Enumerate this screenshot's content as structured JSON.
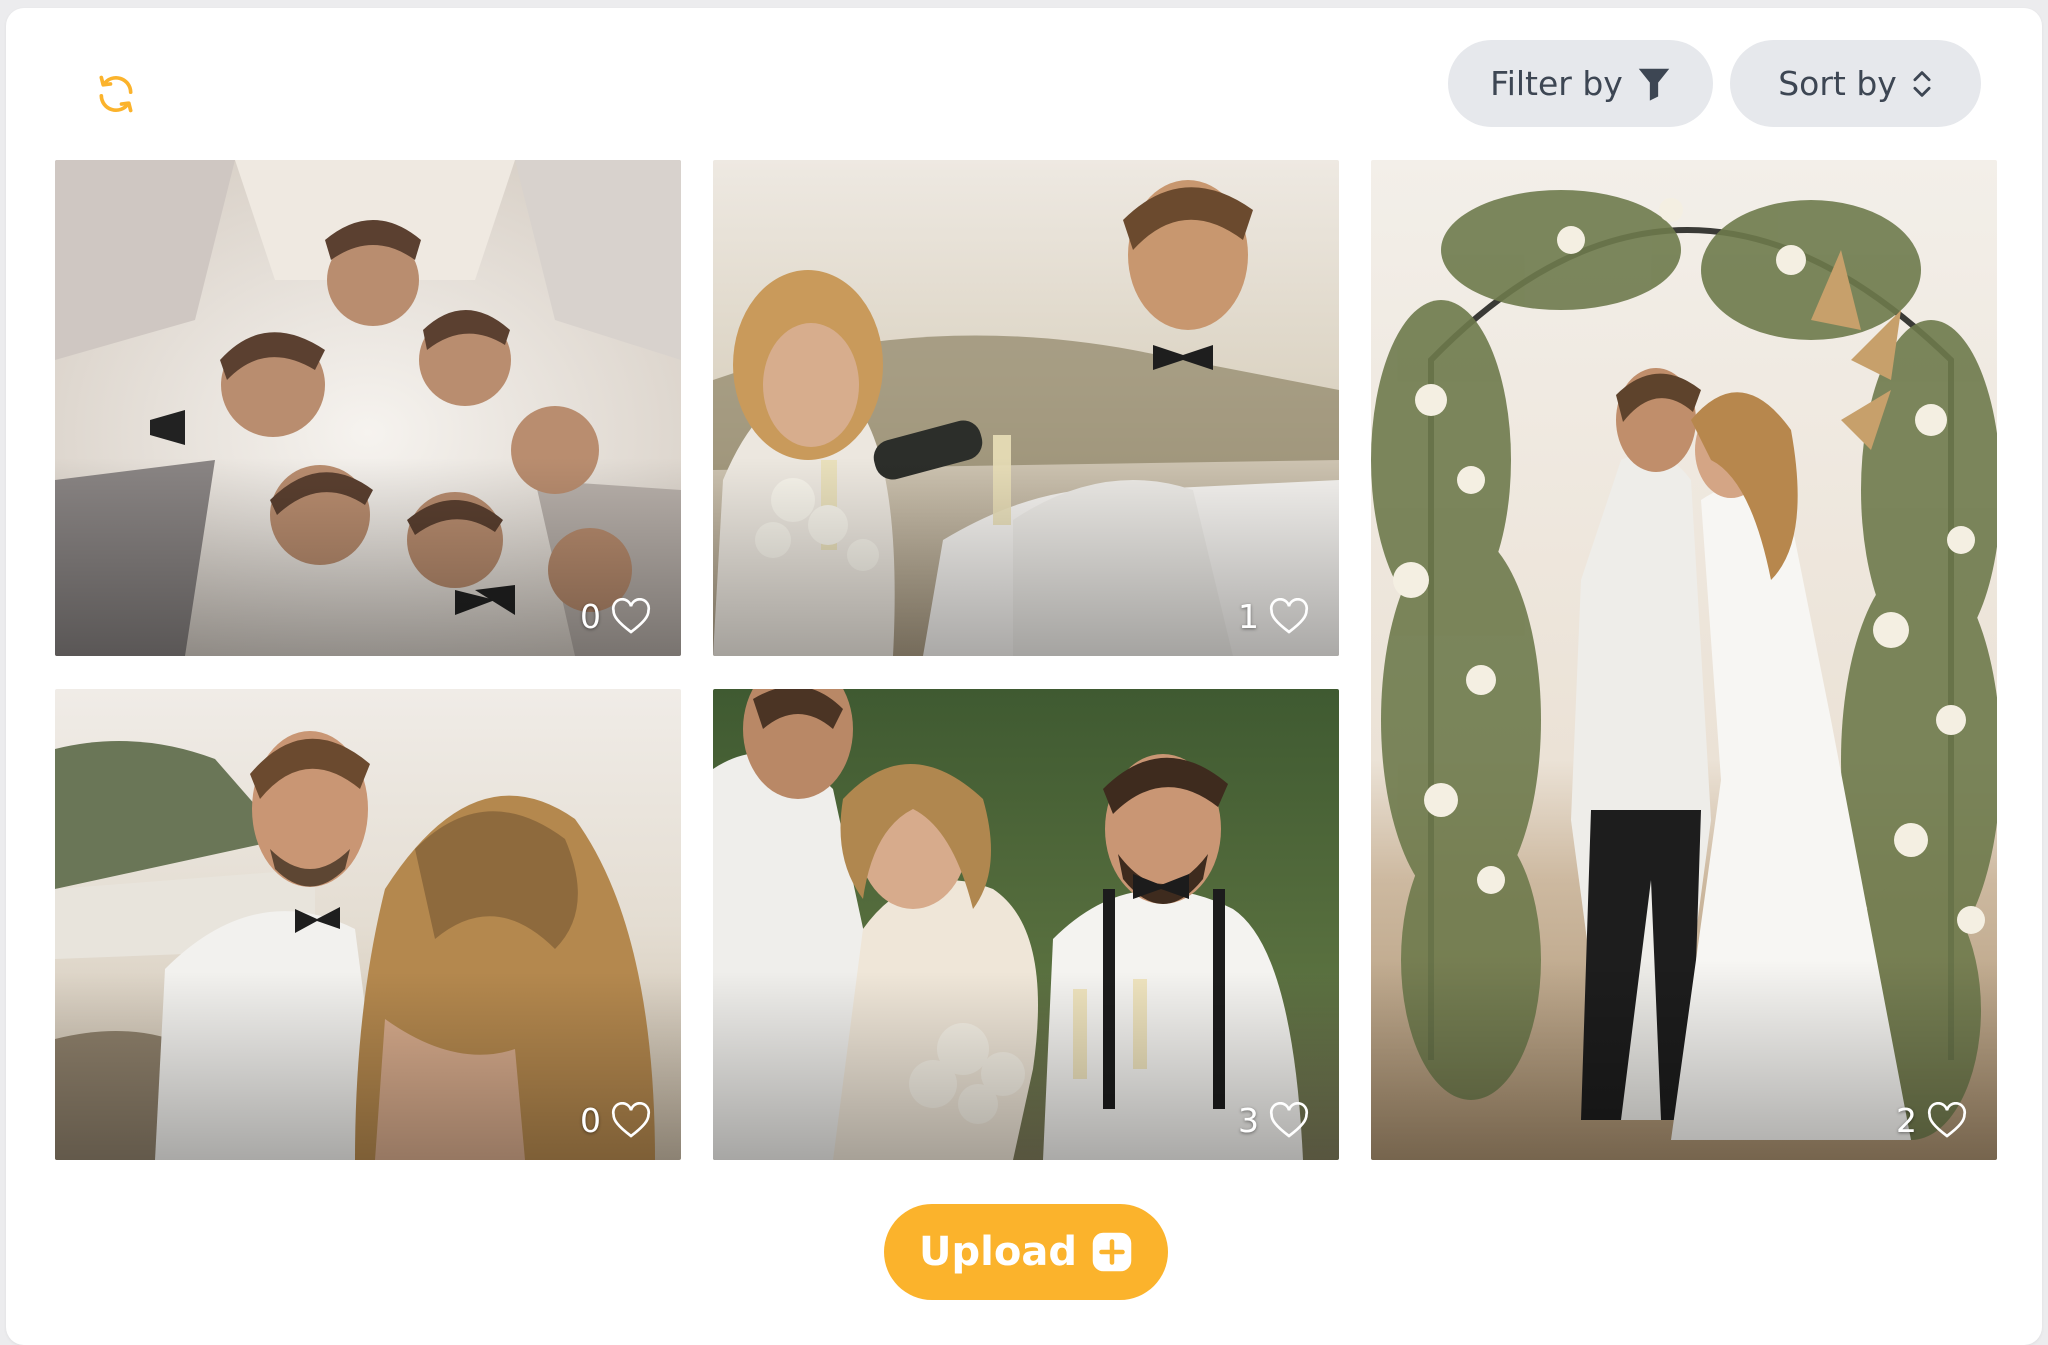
{
  "toolbar": {
    "refresh_icon": "refresh-icon",
    "filter_label": "Filter by",
    "filter_icon": "funnel-icon",
    "sort_label": "Sort by",
    "sort_icon": "chevron-up-down-icon",
    "accent": "#fbb32c"
  },
  "photos": [
    {
      "subject": "wedding guests selfie from below",
      "likes": "0"
    },
    {
      "subject": "groom pouring champagne for bride",
      "likes": "1"
    },
    {
      "subject": "couple embracing under flower arch",
      "likes": "2"
    },
    {
      "subject": "groom smiling at bride by the water",
      "likes": "0"
    },
    {
      "subject": "bride and groom toasting with guests",
      "likes": "3"
    }
  ],
  "like_icon": "heart-icon",
  "upload": {
    "label": "Upload",
    "icon": "plus-square-icon",
    "color": "#fbb32c"
  }
}
